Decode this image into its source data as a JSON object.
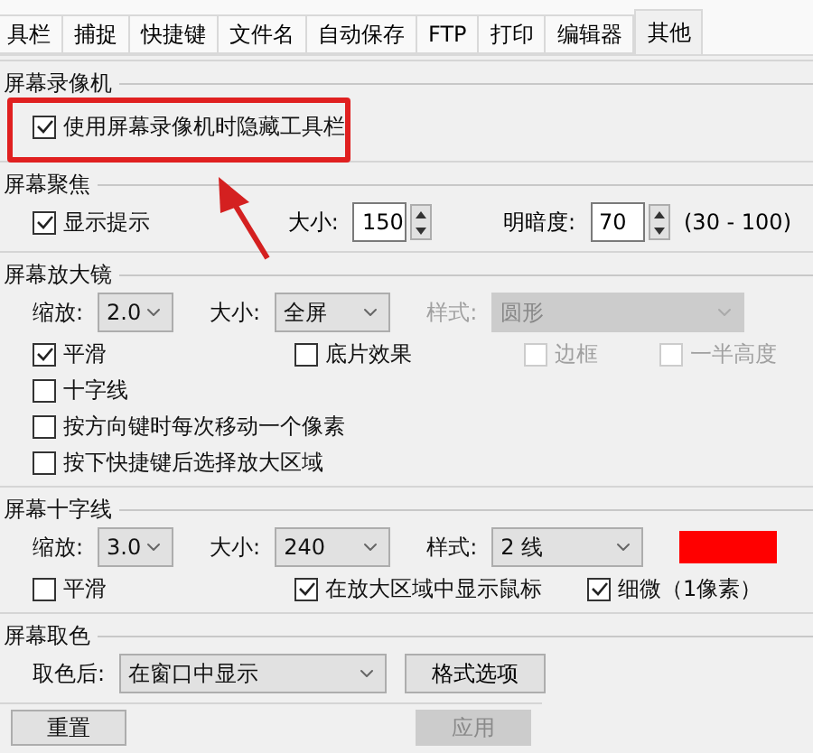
{
  "tabs": [
    {
      "label": "具栏",
      "selected": false
    },
    {
      "label": "捕捉",
      "selected": false
    },
    {
      "label": "快捷键",
      "selected": false
    },
    {
      "label": "文件名",
      "selected": false
    },
    {
      "label": "自动保存",
      "selected": false
    },
    {
      "label": "FTP",
      "selected": false
    },
    {
      "label": "打印",
      "selected": false
    },
    {
      "label": "编辑器",
      "selected": false
    },
    {
      "label": "其他",
      "selected": true
    }
  ],
  "recorder": {
    "title": "屏幕录像机",
    "hide_toolbar": {
      "label": "使用屏幕录像机时隐藏工具栏",
      "checked": true,
      "disabled": false
    }
  },
  "focus": {
    "title": "屏幕聚焦",
    "show_hint": {
      "label": "显示提示",
      "checked": true,
      "disabled": false
    },
    "size": {
      "label": "大小:",
      "value": "150"
    },
    "brightness": {
      "label": "明暗度:",
      "value": "70"
    },
    "range": "(30 - 100)"
  },
  "magnifier": {
    "title": "屏幕放大镜",
    "zoom": {
      "label": "缩放:",
      "value": "2.0",
      "disabled": false
    },
    "size": {
      "label": "大小:",
      "value": "全屏",
      "disabled": false
    },
    "style": {
      "label": "样式:",
      "value": "圆形",
      "disabled": true
    },
    "options": [
      {
        "label": "平滑",
        "checked": true,
        "disabled": false
      },
      {
        "label": "底片效果",
        "checked": false,
        "disabled": false
      },
      {
        "label": "边框",
        "checked": false,
        "disabled": true
      },
      {
        "label": "一半高度",
        "checked": false,
        "disabled": true
      },
      {
        "label": "十字线",
        "checked": false,
        "disabled": false
      },
      {
        "label": "按方向键时每次移动一个像素",
        "checked": false,
        "disabled": false
      },
      {
        "label": "按下快捷键后选择放大区域",
        "checked": false,
        "disabled": false
      }
    ]
  },
  "crosshair": {
    "title": "屏幕十字线",
    "zoom": {
      "label": "缩放:",
      "value": "3.0",
      "disabled": false
    },
    "size": {
      "label": "大小:",
      "value": "240",
      "disabled": false
    },
    "style": {
      "label": "样式:",
      "value": "2 线",
      "disabled": false
    },
    "color": "#ff0000",
    "options": [
      {
        "label": "平滑",
        "checked": false,
        "disabled": false
      },
      {
        "label": "在放大区域中显示鼠标",
        "checked": true,
        "disabled": false
      },
      {
        "label": "细微（1像素）",
        "checked": true,
        "disabled": false
      }
    ]
  },
  "color_picker": {
    "title": "屏幕取色",
    "after": {
      "label": "取色后:",
      "value": "在窗口中显示",
      "disabled": false
    },
    "format_button": "格式选项"
  },
  "buttons": [
    {
      "label": "重置",
      "disabled": false
    },
    {
      "label": "应用",
      "disabled": true
    }
  ]
}
